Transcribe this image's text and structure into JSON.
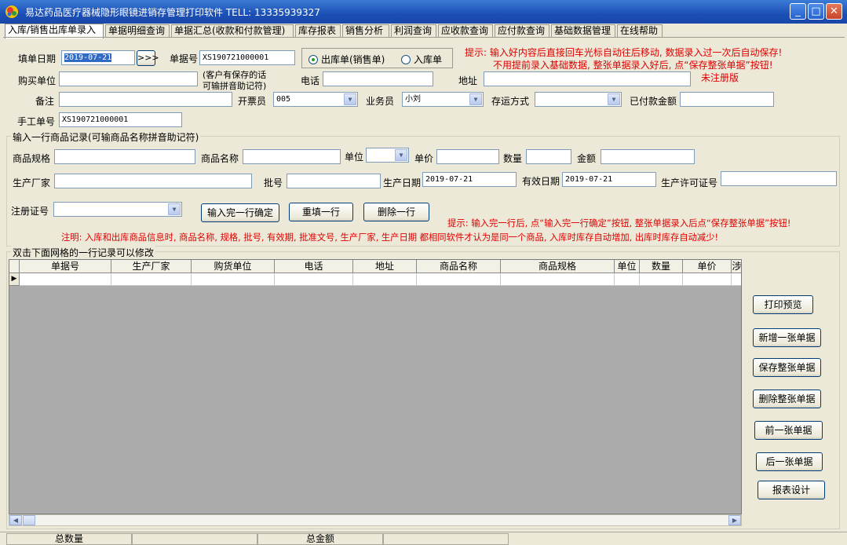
{
  "window": {
    "title": "易达药品医疗器械隐形眼镜进销存管理打印软件  TELL: 13335939327",
    "minimize": "_",
    "maximize": "□",
    "close": "✕"
  },
  "tabs": [
    {
      "label": "入库/销售出库单录入"
    },
    {
      "label": "单据明细查询"
    },
    {
      "label": "单据汇总(收款和付款管理)"
    },
    {
      "label": "库存报表"
    },
    {
      "label": "销售分析"
    },
    {
      "label": "利润查询"
    },
    {
      "label": "应收款查询"
    },
    {
      "label": "应付款查询"
    },
    {
      "label": "基础数据管理"
    },
    {
      "label": "在线帮助"
    }
  ],
  "header_form": {
    "fill_date_label": "填单日期",
    "fill_date_value": "2019-07-21",
    "fill_date_button": ">>>",
    "doc_no_label": "单据号",
    "doc_no_value": "XS190721000001",
    "radio_out": "出库单(销售单)",
    "radio_in": "入库单",
    "buyer_label": "购买单位",
    "buyer_value": "",
    "buyer_hint_1": "(客户有保存的话",
    "buyer_hint_2": "可输拼音助记符)",
    "phone_label": "电话",
    "phone_value": "",
    "address_label": "地址",
    "address_value": "",
    "remark_label": "备注",
    "remark_value": "",
    "issuer_label": "开票员",
    "issuer_value": "005",
    "salesman_label": "业务员",
    "salesman_value": "小刘",
    "shipping_label": "存运方式",
    "shipping_value": "",
    "paid_label": "已付款金额",
    "paid_value": "",
    "manual_no_label": "手工单号",
    "manual_no_value": "XS190721000001",
    "tip_1": "提示: 输入好内容后直接回车光标自动往后移动, 数据录入过一次后自动保存!",
    "tip_2": "不用提前录入基础数据, 整张单据录入好后, 点“保存整张单据”按钮!",
    "tip_3": "未注册版"
  },
  "item_form": {
    "group_title": "输入一行商品记录(可输商品名称拼音助记符)",
    "spec_label": "商品规格",
    "name_label": "商品名称",
    "unit_label": "单位",
    "price_label": "单价",
    "qty_label": "数量",
    "amount_label": "金额",
    "maker_label": "生产厂家",
    "batch_label": "批号",
    "prod_date_label": "生产日期",
    "prod_date_value": "2019-07-21",
    "expiry_label": "有效日期",
    "expiry_value": "2019-07-21",
    "license_label": "生产许可证号",
    "reg_label": "注册证号",
    "confirm_button": "输入完一行确定",
    "refill_button": "重填一行",
    "delete_row_button": "删除一行",
    "tip": "提示: 输入完一行后, 点“输入完一行确定”按钮, 整张单据录入后点“保存整张单据”按钮!",
    "note": "注明: 入库和出库商品信息时, 商品名称, 规格, 批号, 有效期, 批准文号, 生产厂家, 生产日期  都相同软件才认为是同一个商品, 入库时库存自动增加, 出库时库存自动减少!"
  },
  "grid": {
    "group_title": "双击下面网格的一行记录可以修改",
    "columns": [
      "单据号",
      "生产厂家",
      "购货单位",
      "电话",
      "地址",
      "商品名称",
      "商品规格",
      "单位",
      "数量",
      "单价",
      "涉"
    ],
    "row_indicator": "▶"
  },
  "side_buttons": {
    "print_preview": "打印预览",
    "new_doc": "新增一张单据",
    "save_doc": "保存整张单据",
    "delete_doc": "删除整张单据",
    "prev_doc": "前一张单据",
    "next_doc": "后一张单据",
    "report_design": "报表设计"
  },
  "status": {
    "total_qty_label": "总数量",
    "total_amount_label": "总金额"
  },
  "icons": {
    "app": "app-logo-icon",
    "combo_arrow": "chevron-down-icon",
    "scroll_left": "chevron-left-icon",
    "scroll_right": "chevron-right-icon"
  },
  "colors": {
    "titlebar": "#1b4fb5",
    "tip_text": "#e00000",
    "selection": "#316ac5"
  }
}
